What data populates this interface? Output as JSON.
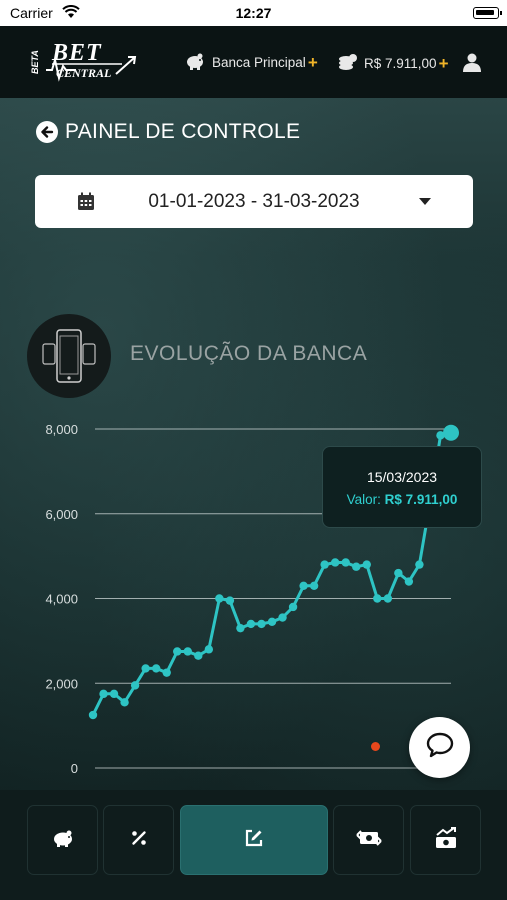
{
  "status_bar": {
    "carrier": "Carrier",
    "time": "12:27"
  },
  "header": {
    "logo": {
      "beta": "BETA",
      "bet": "BET",
      "central": "CENTRAL"
    },
    "bank_label": "Banca Principal",
    "balance": "R$ 7.911,00",
    "plus": "+"
  },
  "page": {
    "title": "PAINEL DE CONTROLE",
    "date_range": "01-01-2023 - 31-03-2023",
    "section_title": "EVOLUÇÃO DA BANCA"
  },
  "tooltip": {
    "date": "15/03/2023",
    "label": "Valor: ",
    "value": "R$ 7.911,00"
  },
  "chart_data": {
    "type": "line",
    "y_ticks": [
      "8,000",
      "6,000",
      "4,000",
      "2,000",
      "0"
    ],
    "ylim": [
      0,
      8000
    ],
    "grid": true,
    "color": "#2ec4c4",
    "values": [
      1250,
      1750,
      1750,
      1550,
      1950,
      2350,
      2350,
      2250,
      2750,
      2750,
      2650,
      2800,
      4000,
      3950,
      3300,
      3400,
      3400,
      3450,
      3550,
      3800,
      4300,
      4300,
      4800,
      4850,
      4850,
      4750,
      4800,
      4000,
      4000,
      4600,
      4400,
      4800,
      6250,
      7850,
      7911
    ],
    "highlighted_point": {
      "date": "15/03/2023",
      "value": 7911
    }
  },
  "bottom_nav": {
    "items": [
      "piggy-bank",
      "percent",
      "edit",
      "money-exchange",
      "money-chart"
    ],
    "active_index": 2
  },
  "colors": {
    "accent": "#2ec4c4",
    "plus": "#f0b429",
    "notification": "#e8471c"
  }
}
